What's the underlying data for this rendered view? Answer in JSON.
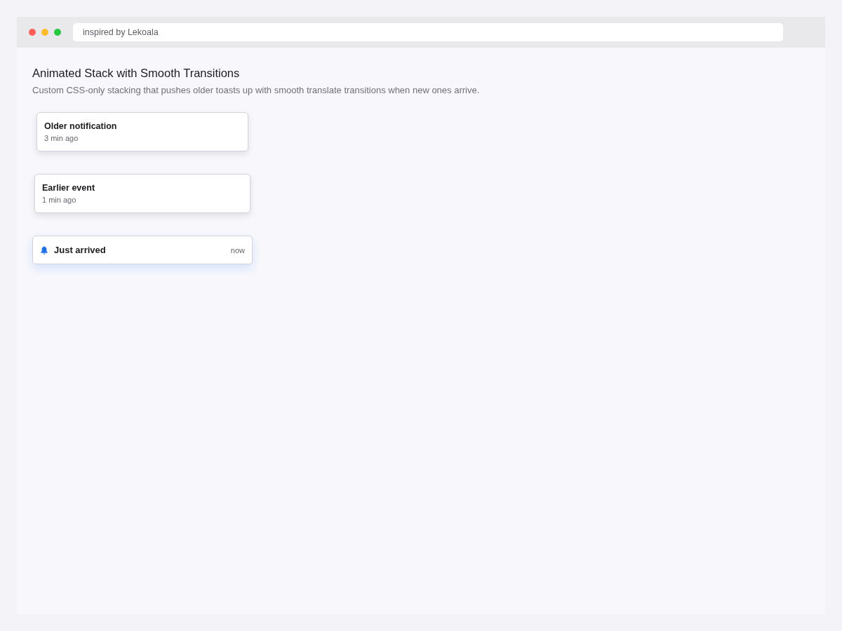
{
  "browser": {
    "address": "inspired by Lekoala"
  },
  "page": {
    "title": "Animated Stack with Smooth Transitions",
    "subtitle": "Custom CSS-only stacking that pushes older toasts up with smooth translate transitions when new ones arrive."
  },
  "toasts": [
    {
      "kind": "detailed",
      "title": "Older notification",
      "time": "3 min ago"
    },
    {
      "kind": "detailed",
      "title": "Earlier event",
      "time": "1 min ago"
    },
    {
      "kind": "inline",
      "title": "Just arrived",
      "time": "now"
    }
  ]
}
